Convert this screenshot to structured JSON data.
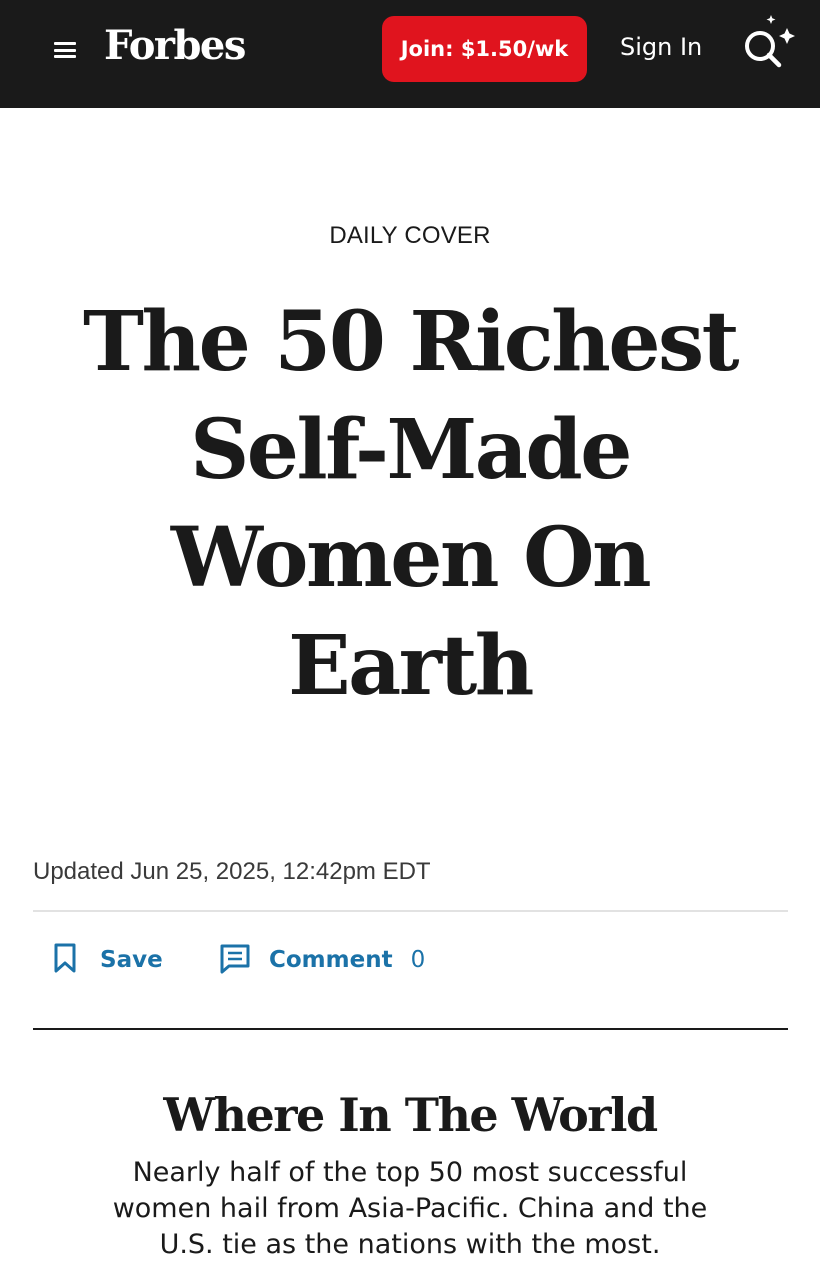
{
  "header": {
    "logo": "Forbes",
    "join_label": "Join: $1.50/wk",
    "signin_label": "Sign In",
    "icons": {
      "menu": "hamburger-menu-icon",
      "search": "search-sparkle-icon"
    },
    "colors": {
      "bar": "#1a1a1a",
      "join": "#e0141e"
    }
  },
  "article": {
    "kicker": "DAILY COVER",
    "headline": "The 50 Richest Self-Made Women On Earth",
    "updated": "Updated Jun 25, 2025, 12:42pm EDT",
    "actions": {
      "save_label": "Save",
      "comment_label": "Comment",
      "comment_count": "0",
      "icons": {
        "save": "bookmark-icon",
        "comment": "comment-icon"
      },
      "color": "#1b72a8"
    }
  },
  "section": {
    "title": "Where In The World",
    "body": "Nearly half of the top 50 most successful women hail from Asia-Pacific. China and the U.S. tie as the nations with the most."
  }
}
